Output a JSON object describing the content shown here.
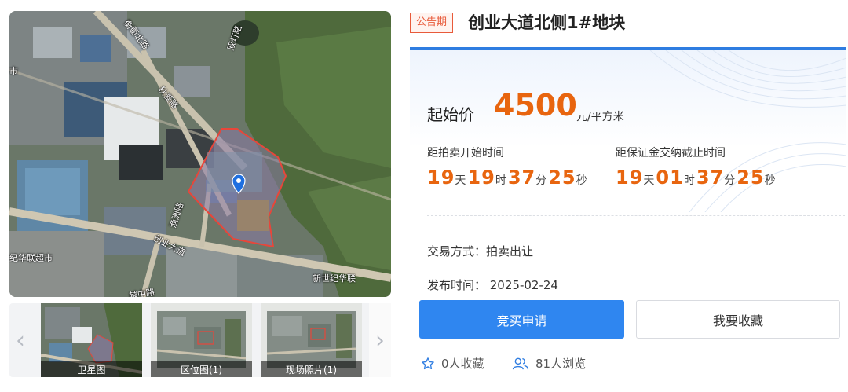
{
  "map": {
    "labels": {
      "road_north": "衡衢北路",
      "road_shuangdeng": "双灯路",
      "road_dongling": "秋菱路",
      "road_yuzhou": "渔洲路",
      "road_chuangye": "创业大道",
      "road_south": "越中路",
      "left_edge": "市",
      "supermarket": "纪华联超市",
      "store_bottom": "新世纪华联"
    }
  },
  "thumbnails": [
    {
      "caption": "卫星图"
    },
    {
      "caption": "区位图(1)"
    },
    {
      "caption": "现场照片(1)"
    }
  ],
  "header": {
    "status": "公告期",
    "title": "创业大道北侧1#地块"
  },
  "price": {
    "label": "起始价",
    "value": "4500",
    "unit": "元/平方米"
  },
  "countdowns": [
    {
      "title": "距拍卖开始时间",
      "days": "19",
      "days_unit": "天",
      "hours": "19",
      "hours_unit": "时",
      "minutes": "37",
      "minutes_unit": "分",
      "seconds": "25",
      "seconds_unit": "秒"
    },
    {
      "title": "距保证金交纳截止时间",
      "days": "19",
      "days_unit": "天",
      "hours": "01",
      "hours_unit": "时",
      "minutes": "37",
      "minutes_unit": "分",
      "seconds": "25",
      "seconds_unit": "秒"
    }
  ],
  "info": {
    "trade_method": "交易方式：拍卖出让",
    "publish_time": "发布时间： 2025-02-24"
  },
  "actions": {
    "bid_label": "竞买申请",
    "favorite_label": "我要收藏"
  },
  "stats": {
    "favorites": "0人收藏",
    "views": "81人浏览"
  },
  "colors": {
    "accent": "#2f86f0",
    "price": "#e8650f",
    "badge": "#e85a3a",
    "parcel_outline": "#e8463a"
  }
}
